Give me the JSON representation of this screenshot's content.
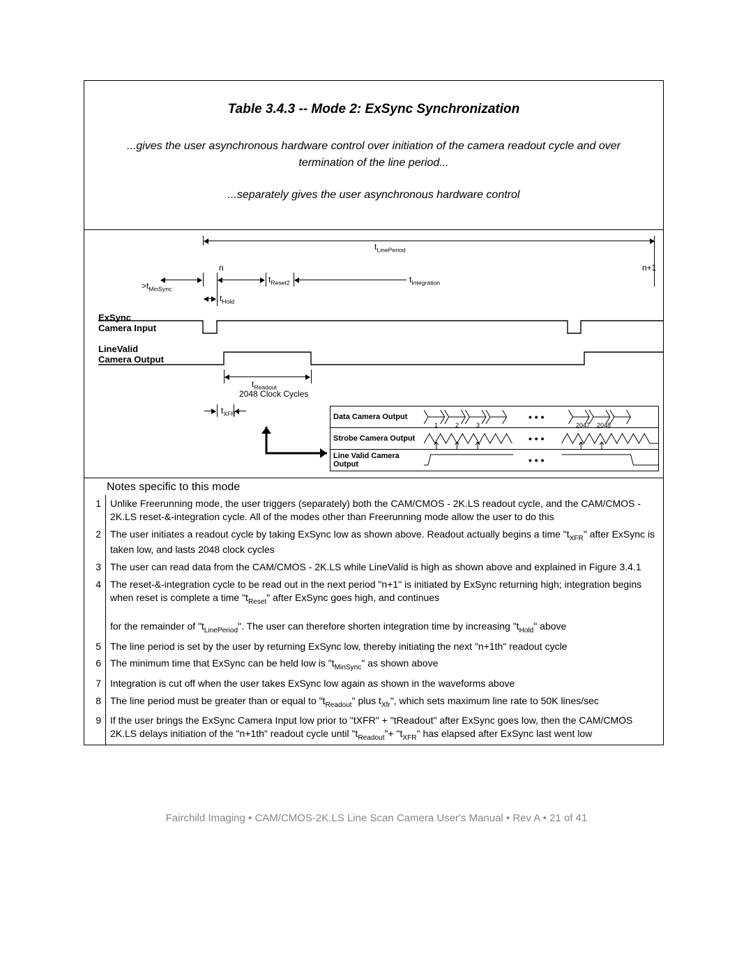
{
  "title": "Table 3.4.3    --    Mode 2:  ExSync Synchronization",
  "subtitle1": "...gives the user asynchronous hardware control over initiation of the camera readout cycle and over termination of the line period...",
  "subtitle2": "...separately gives the user asynchronous hardware control",
  "diagram": {
    "tLinePeriod": "t",
    "tLinePeriod_sub": "LinePeriod",
    "n": "n",
    "n1": "n+1",
    "gtMinSync_pre": ">t",
    "gtMinSync_sub": "MinSync",
    "tReset2": "t",
    "tReset2_sub": "Reset2",
    "tIntegration": "t",
    "tIntegration_sub": "Integration",
    "tHold": "t",
    "tHold_sub": "Hold",
    "exsync_l1": "ExSync",
    "exsync_l2": "Camera Input",
    "linevalid_l1": "LineValid",
    "linevalid_l2": "Camera Output",
    "tReadout": "t",
    "tReadout_sub": "Readout",
    "readout_cycles": "2048 Clock Cycles",
    "tXFR": "t",
    "tXFR_sub": "XFR",
    "data_out": "Data Camera Output",
    "strobe_out": "Strobe Camera Output",
    "lvalid_out": "Line Valid Camera Output",
    "d1": "1",
    "d2": "2",
    "d3": "3",
    "d2047": "2047",
    "d2048": "2048",
    "dots": "• • •"
  },
  "notes_header": "Notes specific to this mode",
  "notes": [
    {
      "n": "1",
      "t": "Unlike Freerunning mode, the user triggers (separately) both the CAM/CMOS - 2K.LS readout cycle, and the CAM/CMOS - 2K.LS reset-&-integration cycle.   All of the modes other than Freerunning mode allow the user to do this"
    },
    {
      "n": "2",
      "t": "The user initiates a readout cycle by taking ExSync low as shown above.  Readout actually begins a time \"t<sub>XFR</sub>\" after ExSync is taken low, and lasts 2048 clock cycles"
    },
    {
      "n": "3",
      "t": "The user can read data from the CAM/CMOS - 2K.LS while LineValid is high as shown above and explained in Figure 3.4.1"
    },
    {
      "n": "4",
      "t": "The reset-&-integration cycle to be read out in the next period \"n+1\" is initiated by ExSync returning high; integration begins when reset is complete a time \"t<sub>Reset</sub>\" after ExSync goes high, and continues<br><br>for the remainder of \"t<sub>LinePeriod</sub>\". The user can therefore shorten integration time by increasing \"t<sub>Hold</sub>\" above"
    },
    {
      "n": "5",
      "t": "The line period is set by the user by returning ExSync low, thereby initiating the next \"n+1th\" readout cycle"
    },
    {
      "n": "6",
      "t": "The minimum time that ExSync can be held low is \"t<sub>MinSync</sub>\" as shown above"
    },
    {
      "n": "7",
      "t": "Integration is cut off when the user takes ExSync low again as shown in the waveforms above"
    },
    {
      "n": "8",
      "t": "The line period must be greater than or equal to \"t<sub>Readout</sub>\" plus t<sub>Xfr</sub>\", which sets maximum line rate to 50K lines/sec"
    },
    {
      "n": "9",
      "t": "If the user brings the ExSync Camera Input low prior to \"tXFR\" + \"tReadout\" after ExSync goes low, then the CAM/CMOS 2K.LS delays initiation of the \"n+1th\" readout cycle until \"t<sub>Readout</sub>\"+ \"t<sub>XFR</sub>\" has elapsed after ExSync last went low"
    }
  ],
  "footer": "Fairchild Imaging • CAM/CMOS-2K.LS Line Scan Camera User's Manual • Rev A • 21 of 41"
}
